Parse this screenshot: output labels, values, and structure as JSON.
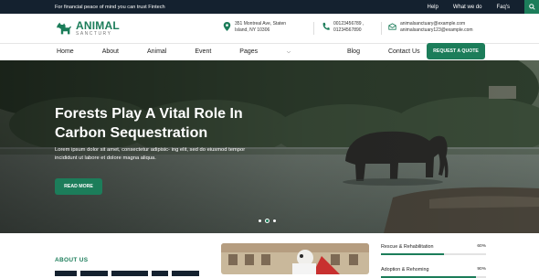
{
  "topbar": {
    "tagline": "For financial peace of mind you can trust Fintech",
    "links": [
      "Help",
      "What we do",
      "Faq's"
    ],
    "search_icon": "search-icon"
  },
  "logo": {
    "title": "ANIMAL",
    "subtitle": "SANCTURY",
    "icon": "dog-icon"
  },
  "contact": {
    "address": [
      "351 Montreal Ave, Staten",
      "Island, NY 10306"
    ],
    "phones": [
      "00123456789 ,",
      "01234567890"
    ],
    "emails": [
      "animalsanctuary@example.com",
      "animalsanctuary123@example.com"
    ]
  },
  "nav": {
    "items": [
      "Home",
      "About",
      "Animal",
      "Event",
      "Pages",
      "Blog",
      "Contact Us"
    ],
    "quote_button": "REQUEST A QUOTE"
  },
  "hero": {
    "title": "Forests Play A Vital Role In Carbon Sequestration",
    "description": "Lorem ipsum dolor sit amet, consectetur adipisic- ing elit, sed do eiusmod tempor incididunt ut labore et dolore magna aliqua.",
    "button": "READ MORE",
    "slides": 3,
    "active_slide": 2
  },
  "about": {
    "label": "ABOUT US"
  },
  "stats": [
    {
      "label": "Rescue & Rehabilitation",
      "value": "60%",
      "fraction": 0.6
    },
    {
      "label": "Adoption & Rehoming",
      "value": "90%",
      "fraction": 0.9
    }
  ],
  "colors": {
    "brand": "#1c7d5a",
    "topbar": "#14212f"
  }
}
